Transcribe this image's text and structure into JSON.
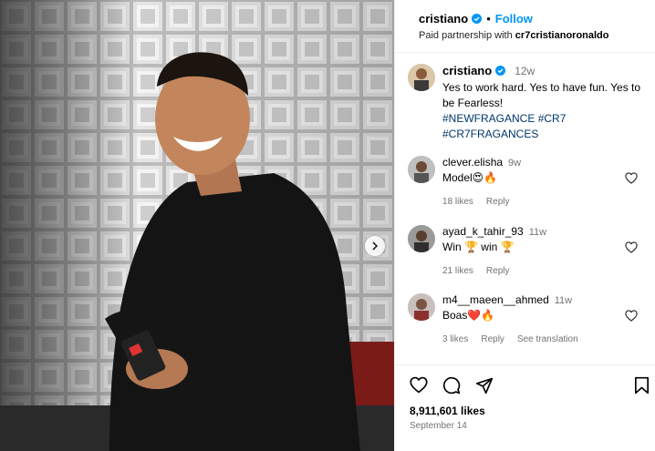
{
  "post": {
    "username": "cristiano",
    "follow_label": "Follow",
    "dot": "•",
    "partnership_prefix": "Paid partnership with",
    "partner": "cr7cristianoronaldo"
  },
  "caption": {
    "username": "cristiano",
    "time": "12w",
    "text": "Yes to work hard. Yes to have fun. Yes to be Fearless!",
    "hashtags": [
      "#NEWFRAGANCE",
      "#CR7",
      "#CR7FRAGANCES"
    ]
  },
  "comments": [
    {
      "username": "clever.elisha",
      "time": "9w",
      "text": "Model😍🔥",
      "likes": "18 likes",
      "reply": "Reply",
      "translate": ""
    },
    {
      "username": "ayad_k_tahir_93",
      "time": "11w",
      "text": "Win 🏆 win 🏆",
      "likes": "21 likes",
      "reply": "Reply",
      "translate": ""
    },
    {
      "username": "m4__maeen__ahmed",
      "time": "11w",
      "text": "Boas❤️🔥",
      "likes": "3 likes",
      "reply": "Reply",
      "translate": "See translation"
    }
  ],
  "footer": {
    "likes": "8,911,601 likes",
    "date": "September 14"
  },
  "colors": {
    "accent": "#0095f6",
    "hashtag": "#00376b",
    "verified": "#0095f6",
    "muted": "#737373"
  },
  "icons": [
    "verified-badge-icon",
    "heart-icon",
    "comment-icon",
    "share-icon",
    "bookmark-icon",
    "chevron-right-icon"
  ]
}
